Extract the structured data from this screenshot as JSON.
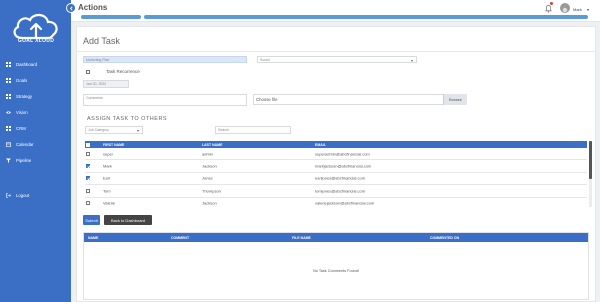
{
  "brand": {
    "logo_text": "GOAL XLOUD"
  },
  "sidebar": {
    "items": [
      {
        "label": "Dashboard",
        "icon": "dashboard-icon"
      },
      {
        "label": "Goals",
        "icon": "goals-icon"
      },
      {
        "label": "Strategy",
        "icon": "strategy-icon"
      },
      {
        "label": "Vision",
        "icon": "vision-icon"
      },
      {
        "label": "CRM",
        "icon": "crm-icon"
      },
      {
        "label": "Calendar",
        "icon": "calendar-icon"
      },
      {
        "label": "Pipeline",
        "icon": "pipeline-icon"
      }
    ],
    "logout": "Logout"
  },
  "header": {
    "title": "Actions",
    "user_name": "Mark",
    "caret": "▾"
  },
  "panel": {
    "title": "Add Task",
    "fields": {
      "task_name": "Marketing Plan",
      "goal_select": "Social",
      "recurrence_label": "Task Recurrence",
      "date": "Jan 20, 2022",
      "comments_placeholder": "Comments",
      "file_label": "Choose file",
      "browse_label": "Browse"
    },
    "assign": {
      "section_title": "ASSIGN TASK TO OTHERS",
      "category_placeholder": "Job Category",
      "search_placeholder": "Search"
    },
    "users_table": {
      "headers": [
        "FIRST NAME",
        "LAST NAME",
        "EMAIL"
      ],
      "rows": [
        {
          "first": "super",
          "last": "admin",
          "email": "superadmin@abcfinancial.com",
          "checked": false
        },
        {
          "first": "Mark",
          "last": "Jackson",
          "email": "markjackson@abcfinancial.com",
          "checked": true
        },
        {
          "first": "Earl",
          "last": "Jones",
          "email": "earljones@abcfinancial.com",
          "checked": true
        },
        {
          "first": "Tom",
          "last": "Thompson",
          "email": "tomjones@abcfinancial.com",
          "checked": false
        },
        {
          "first": "Valerie",
          "last": "Jackson",
          "email": "valeriejackson@abcfinancial.com",
          "checked": false
        }
      ]
    },
    "buttons": {
      "submit": "Submit",
      "back": "Back to Dashboard"
    },
    "comments_table": {
      "headers": [
        "NAME",
        "COMMENT",
        "FILE NAME",
        "COMMENTED ON"
      ],
      "empty_text": "No Task Comments Found!"
    }
  },
  "colors": {
    "primary": "#3a6fc5",
    "progress": "#5b9bd5",
    "dark_button": "#444444"
  }
}
